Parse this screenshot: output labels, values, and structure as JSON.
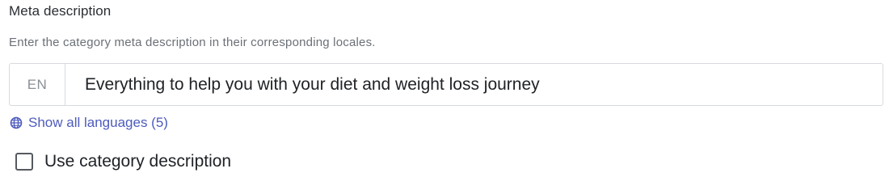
{
  "meta_description": {
    "label": "Meta description",
    "help_text": "Enter the category meta description in their corresponding locales.",
    "locale": "EN",
    "value": "Everything to help you with your diet and weight loss journey",
    "show_languages_link": "Show all languages (5)",
    "globe_icon": "globe-icon",
    "link_color": "#4d5bbd"
  },
  "use_category_description": {
    "label": "Use category description",
    "checked": false
  }
}
